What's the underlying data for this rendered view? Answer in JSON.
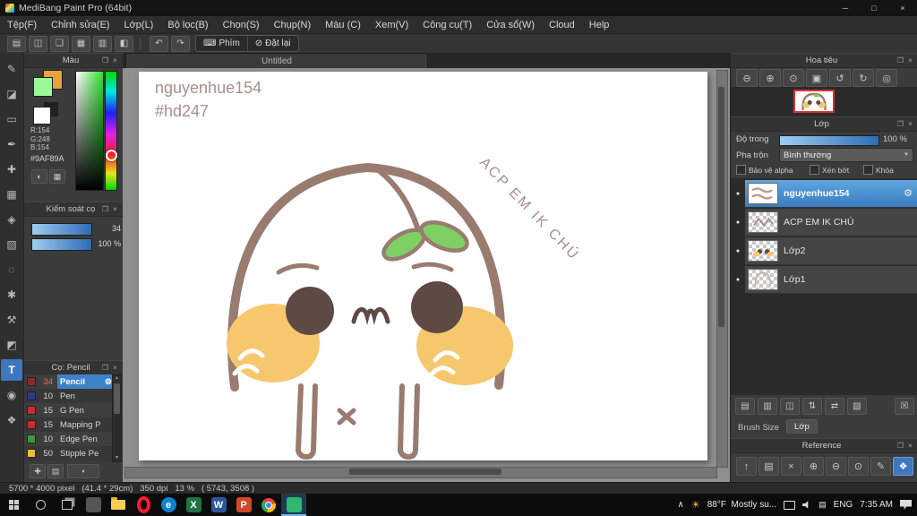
{
  "window": {
    "title": "MediBang Paint Pro (64bit)"
  },
  "menubar": {
    "items": [
      "Tệp(F)",
      "Chỉnh sửa(E)",
      "Lớp(L)",
      "Bộ lọc(B)",
      "Chọn(S)",
      "Chụp(N)",
      "Màu (C)",
      "Xem(V)",
      "Công cụ(T)",
      "Cửa sổ(W)",
      "Cloud",
      "Help"
    ]
  },
  "toolbar": {
    "phim": "Phím",
    "dat_lai": "Đặt lại"
  },
  "document": {
    "tab": "Untitled",
    "signature_line1": "nguyenhue154",
    "signature_line2": "#hd247",
    "diagonal_text": "ACP EM IK CHÚ"
  },
  "tools": [
    {
      "name": "brush-tool",
      "glyph": "✎"
    },
    {
      "name": "eraser-tool",
      "glyph": "◪"
    },
    {
      "name": "figure-tool",
      "glyph": "▭"
    },
    {
      "name": "pen-tool",
      "glyph": "✒"
    },
    {
      "name": "move-tool",
      "glyph": "✚"
    },
    {
      "name": "select-tool",
      "glyph": "▦"
    },
    {
      "name": "bucket-tool",
      "glyph": "◈"
    },
    {
      "name": "gradient-tool",
      "glyph": "▨"
    },
    {
      "name": "lasso-tool",
      "glyph": "◌"
    },
    {
      "name": "magic-wand-tool",
      "glyph": "✱"
    },
    {
      "name": "operation-tool",
      "glyph": "⚒"
    },
    {
      "name": "divide-tool",
      "glyph": "◩"
    },
    {
      "name": "text-tool",
      "glyph": "T",
      "selected": true
    },
    {
      "name": "eyedropper-tool",
      "glyph": "◉"
    },
    {
      "name": "hand-tool",
      "glyph": "❖"
    }
  ],
  "color_panel": {
    "title": "Màu",
    "r": "R:154",
    "g": "G:248",
    "b": "B:154",
    "hex": "#9AF89A"
  },
  "brush_control": {
    "title": "Kiểm soát cọ",
    "size": "34",
    "opacity": "100 %"
  },
  "brush_panel": {
    "title": "Cọ: Pencil",
    "brushes": [
      {
        "num": "34",
        "name": "Pencil",
        "swatch": "#8a2a2a",
        "selected": true
      },
      {
        "num": "10",
        "name": "Pen",
        "swatch": "#2a3a8a"
      },
      {
        "num": "15",
        "name": "G Pen",
        "swatch": "#c03030"
      },
      {
        "num": "15",
        "name": "Mapping P",
        "swatch": "#c03030"
      },
      {
        "num": "10",
        "name": "Edge Pen",
        "swatch": "#3a9a3a"
      },
      {
        "num": "50",
        "name": "Stipple Pe",
        "swatch": "#e8c030"
      }
    ]
  },
  "navigator": {
    "title": "Hoa tiêu"
  },
  "layer_panel": {
    "title": "Lớp",
    "opacity_label": "Độ trong",
    "opacity_value": "100 %",
    "blend_label": "Pha trộn",
    "blend_value": "Bình thường",
    "check_alpha": "Bảo vệ alpha",
    "check_clip": "Xén bớt",
    "check_lock": "Khóa",
    "layers": [
      {
        "name": "nguyenhue154",
        "selected": true
      },
      {
        "name": "ACP EM IK CHÚ"
      },
      {
        "name": "Lớp2"
      },
      {
        "name": "Lớp1"
      }
    ],
    "tab_brush_size": "Brush Size",
    "tab_lop": "Lớp"
  },
  "reference_panel": {
    "title": "Reference"
  },
  "statusbar": {
    "text": "5700 * 4000 pixel   (41.4 * 29cm)   350 dpi   13 %   ( 5743, 3508 )"
  },
  "taskbar": {
    "weather": "88°F  Mostly su...",
    "lang": "ENG",
    "time": "7:35 AM"
  },
  "colors": {
    "accent_blue": "#3e82c8",
    "selected_layer_blue": "#4a94d4",
    "current_color": "#9AF89A",
    "canvas_bg": "#8f8f8f",
    "outline_taupe": "#9a7b70",
    "cheek_orange": "#f7c76d",
    "sprout_green": "#7ed063",
    "thumb_border_red": "#e03030"
  },
  "glyphs": {
    "min": "─",
    "max": "□",
    "close": "×",
    "popout": "❐",
    "open": "▤",
    "save": "◫",
    "comment": "❑",
    "image": "▦",
    "grid": "▥",
    "material": "◧",
    "undo": "↶",
    "redo": "↷",
    "keyboard": "⌨",
    "no": "⊘",
    "zoom_out": "⊖",
    "zoom_in": "⊕",
    "zoom_actual": "⊙",
    "fit": "▣",
    "rotate_ccw": "↺",
    "rotate_cw": "↻",
    "reset_view": "◎",
    "gear": "⚙",
    "eye": "●",
    "caret_down": "▼",
    "caret_small": "▾",
    "palette": "◐",
    "swatchgrid": "▦",
    "add_brush": "✚",
    "brush_folder": "▤",
    "new_layer": "▤",
    "new_folder": "▥",
    "duplicate": "◫",
    "reorder": "⇅",
    "transfer": "⇄",
    "merge": "▧",
    "trash": "☒",
    "arrow_up": "↑",
    "pen": "✎",
    "hand": "❖",
    "chevron_up": "∧",
    "sun": "☀",
    "scroll_up": "▲",
    "scroll_down": "▼"
  }
}
